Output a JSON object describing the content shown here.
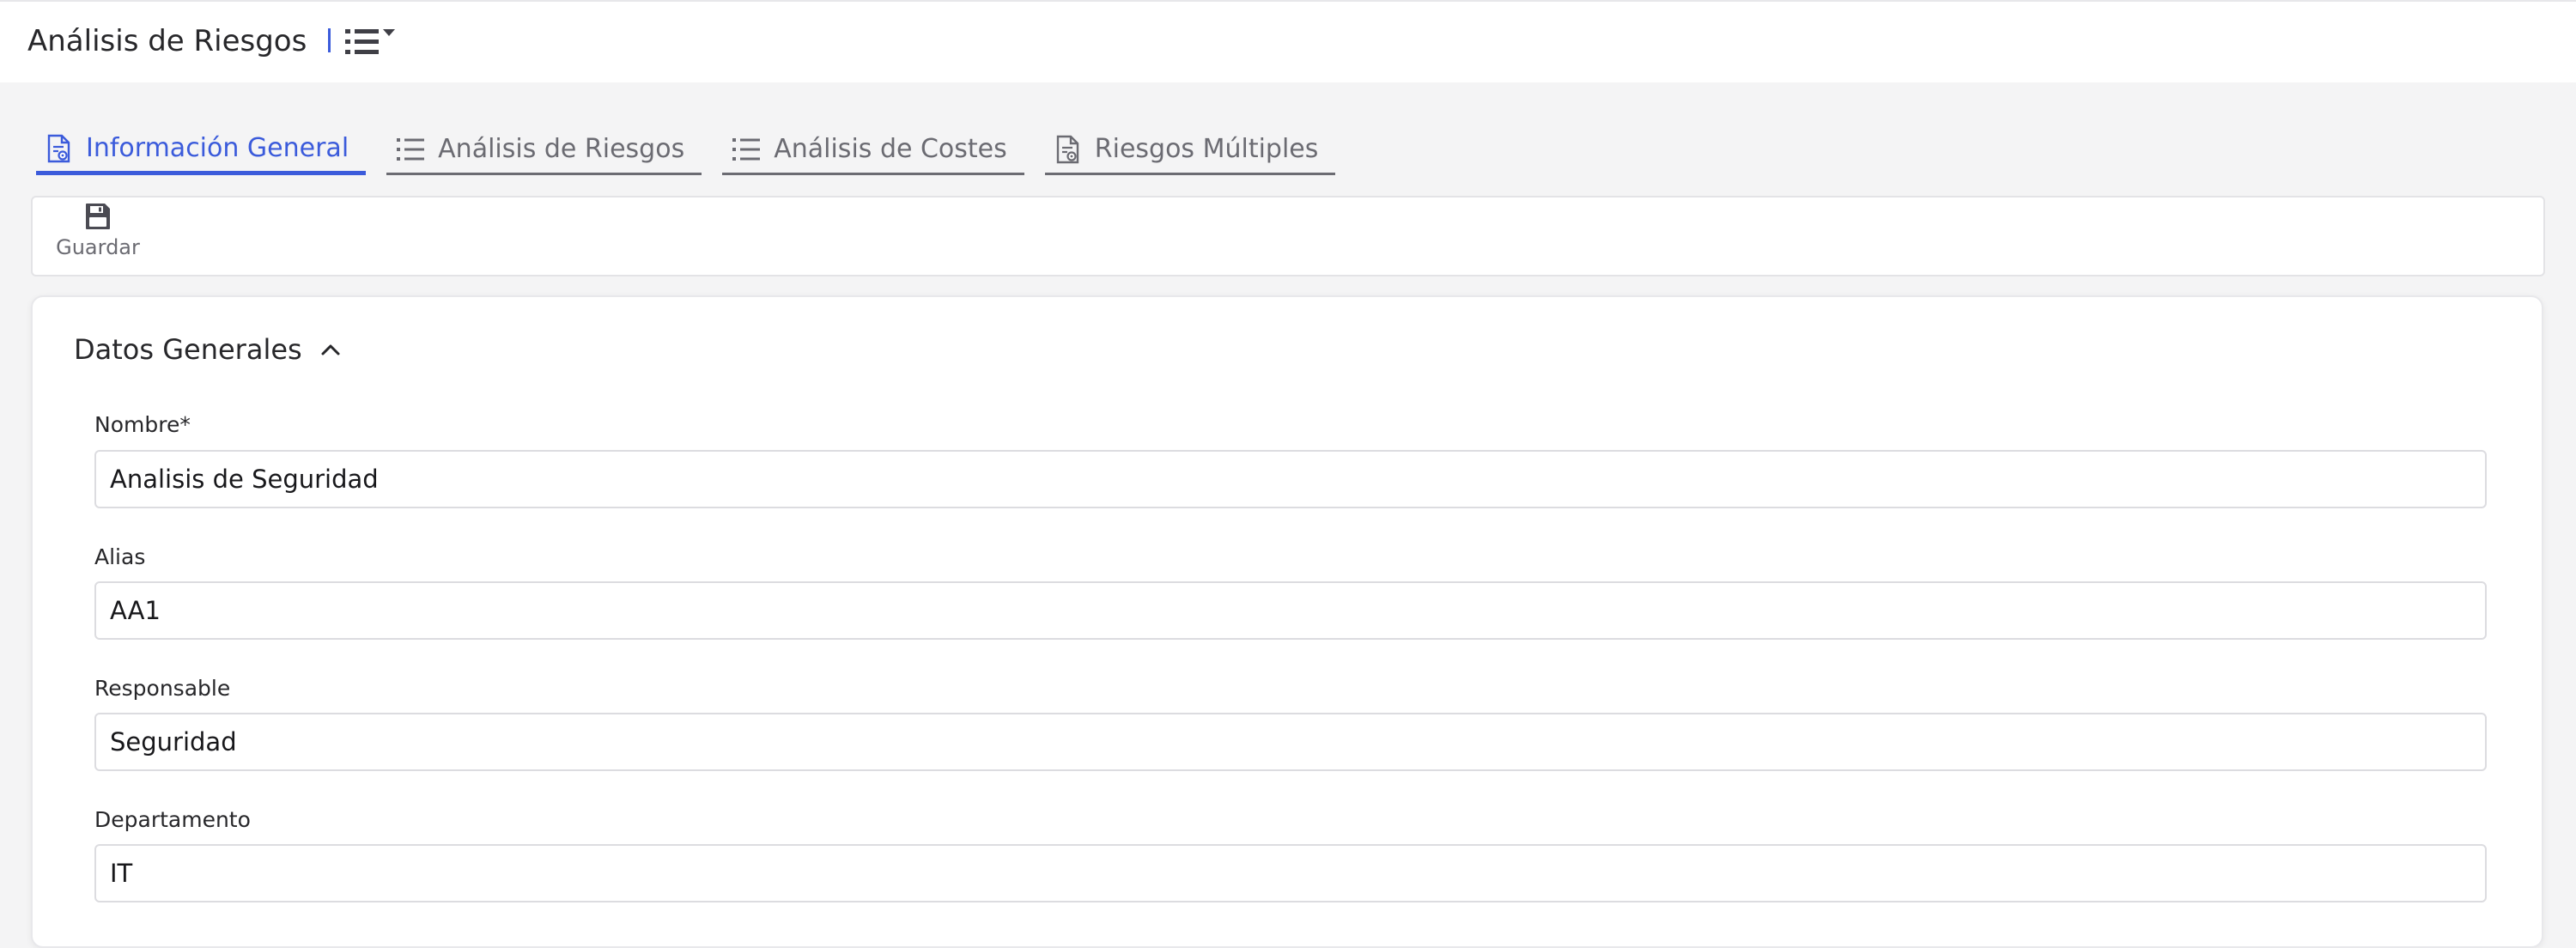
{
  "header": {
    "title": "Análisis de Riesgos",
    "view_menu_icon": "list-ordered-icon"
  },
  "tabs": [
    {
      "label": "Información General",
      "icon": "document-gear-icon",
      "active": true
    },
    {
      "label": "Análisis de Riesgos",
      "icon": "list-icon",
      "active": false
    },
    {
      "label": "Análisis de Costes",
      "icon": "list-icon",
      "active": false
    },
    {
      "label": "Riesgos Múltiples",
      "icon": "document-gear-icon",
      "active": false
    }
  ],
  "toolbar": {
    "save_label": "Guardar",
    "save_icon": "floppy-disk-icon"
  },
  "section": {
    "title": "Datos Generales",
    "expanded": true,
    "fields": [
      {
        "label": "Nombre*",
        "value": "Analisis de Seguridad"
      },
      {
        "label": "Alias",
        "value": "AA1"
      },
      {
        "label": "Responsable",
        "value": "Seguridad"
      },
      {
        "label": "Departamento",
        "value": "IT"
      }
    ]
  },
  "colors": {
    "accent": "#3b5bdb",
    "tab_inactive": "#6b6b72",
    "background": "#f4f4f5"
  }
}
